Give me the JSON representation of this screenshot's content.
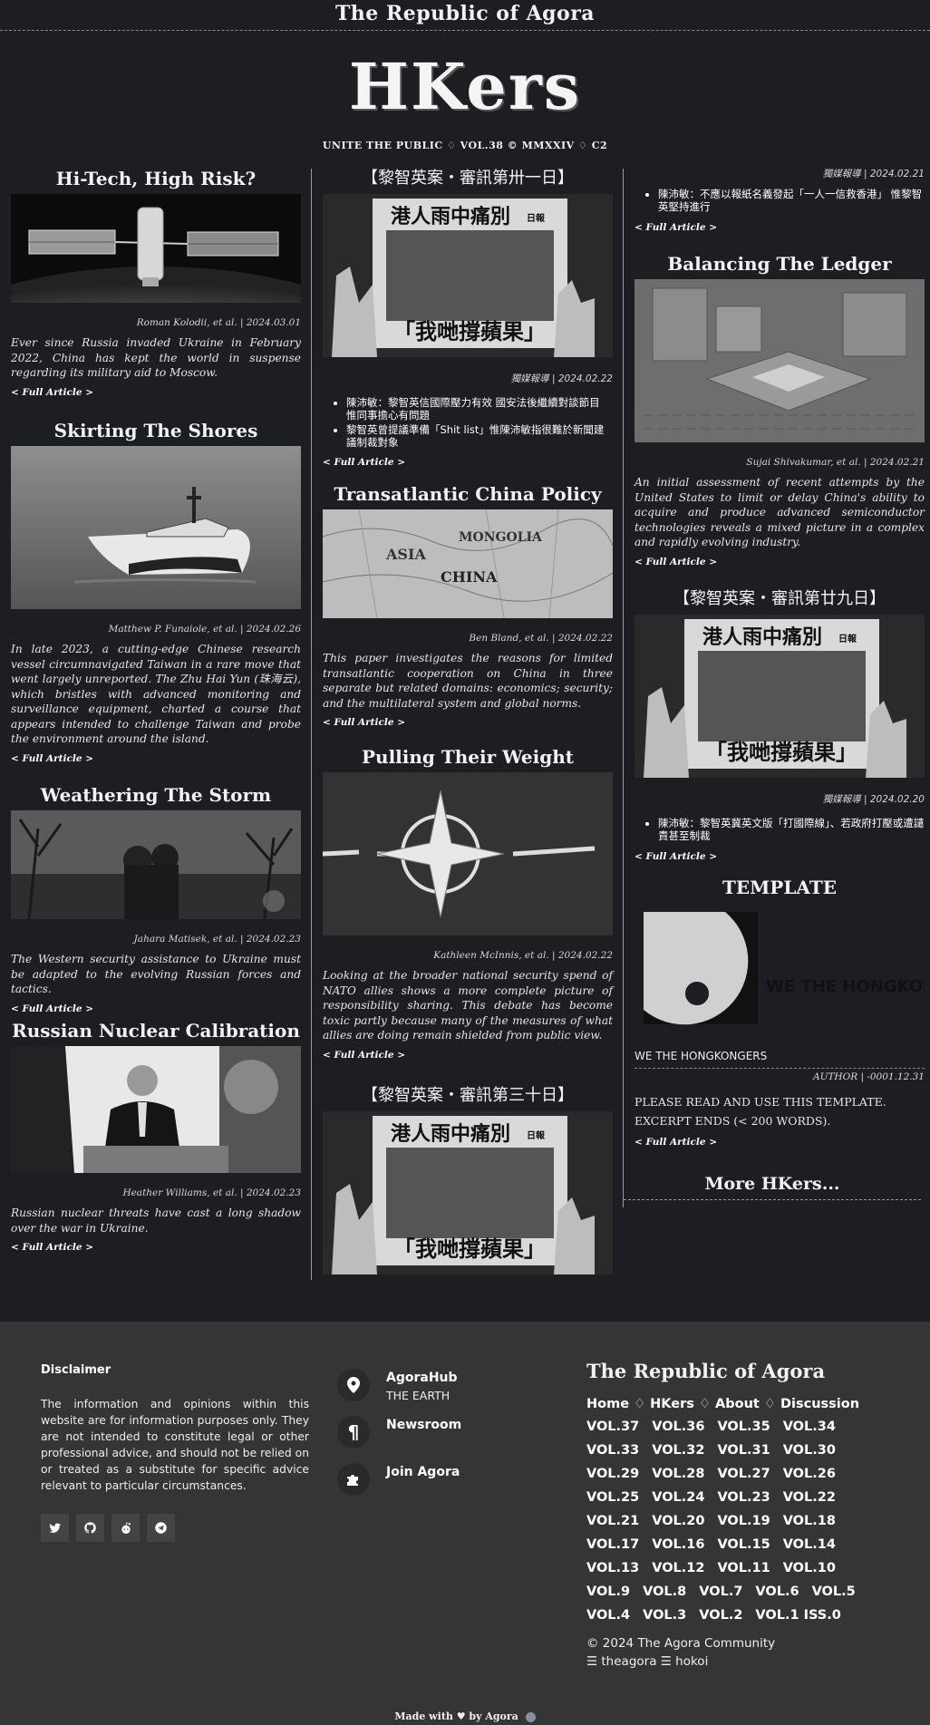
{
  "topbar": {
    "title": "The Republic of Agora"
  },
  "masthead": {
    "logo": "HKers",
    "subline": "UNITE THE PUBLIC ♢ VOL.38 © MMXXIV ♢ C2"
  },
  "full_article_label": "< Full Article >",
  "col1": [
    {
      "title": "Hi-Tech, High Risk?",
      "byline": "Roman Kolodii, et al. | 2024.03.01",
      "summary": "Ever since Russia invaded Ukraine in February 2022, China has kept the world in suspense regarding its military aid to Moscow."
    },
    {
      "title": "Skirting The Shores",
      "byline": "Matthew P. Funaiole, et al. | 2024.02.26",
      "summary": "In late 2023, a cutting-edge Chinese research vessel circumnavigated Taiwan in a rare move that went largely unreported. The Zhu Hai Yun (珠海云), which bristles with advanced monitoring and surveillance equipment, charted a course that appears intended to challenge Taiwan and probe the environment around the island."
    },
    {
      "title": "Weathering The Storm",
      "byline": "Jahara Matisek, et al. | 2024.02.23",
      "summary": "The Western security assistance to Ukraine must be adapted to the evolving Russian forces and tactics."
    },
    {
      "title": "Russian Nuclear Calibration",
      "byline": "Heather Williams, et al. | 2024.02.23",
      "summary": "Russian nuclear threats have cast a long shadow over the war in Ukraine."
    }
  ],
  "col2": [
    {
      "title": "【黎智英案・審訊第卅一日】",
      "byline": "獨媒報導 | 2024.02.22",
      "bullets": [
        "陳沛敏：黎智英信國際壓力有效 國安法後繼續對談節目 惟同事擔心有問題",
        "黎智英曾提議準備「Shit list」惟陳沛敏指很難於新聞建議制裁對象"
      ]
    },
    {
      "title": "Transatlantic China Policy",
      "byline": "Ben Bland, et al. | 2024.02.22",
      "summary": "This paper investigates the reasons for limited transatlantic cooperation on China in three separate but related domains: economics; security; and the multilateral system and global norms."
    },
    {
      "title": "Pulling Their Weight",
      "byline": "Kathleen McInnis, et al. | 2024.02.22",
      "summary": "Looking at the broader national security spend of NATO allies shows a more complete picture of responsibility sharing. This debate has become toxic partly because many of the measures of what allies are doing remain shielded from public view."
    },
    {
      "title": "【黎智英案・審訊第三十日】"
    }
  ],
  "col3": [
    {
      "byline": "獨媒報導 | 2024.02.21",
      "bullets": [
        "陳沛敏：不應以報紙名義發起「一人一信救香港」 惟黎智英堅持進行"
      ]
    },
    {
      "title": "Balancing The Ledger",
      "byline": "Sujai Shivakumar, et al. | 2024.02.21",
      "summary": "An initial assessment of recent attempts by the United States to limit or delay China's ability to acquire and produce advanced semiconductor technologies reveals a mixed picture in a complex and rapidly evolving industry."
    },
    {
      "title": "【黎智英案・審訊第廿九日】",
      "byline": "獨媒報導 | 2024.02.20",
      "bullets": [
        "陳沛敏：黎智英冀英文版「打國際線」、若政府打壓或遭譴責甚至制裁"
      ]
    },
    {
      "title": "TEMPLATE",
      "logo_caption": "WE THE HONGKONGERS",
      "byline_plain": "WE THE HONGKONGERS",
      "meta": "AUTHOR | -0001.12.31",
      "body1": "PLEASE READ AND USE THIS TEMPLATE.",
      "body2": "EXCERPT ENDS (< 200 WORDS)."
    }
  ],
  "more": "More HKers...",
  "newspaper_text": {
    "headline": "港人雨中痛別",
    "bottom": "「我哋撐蘋果」",
    "masthead": "日報",
    "map_label": "CHINA",
    "map_label2": "MONGOLIA",
    "map_label3": "ASIA"
  },
  "footer": {
    "disclaimer_title": "Disclaimer",
    "disclaimer_body": "The information and opinions within this website are for information purposes only. They are not intended to constitute legal or other professional advice, and should not be relied on or treated as a substitute for specific advice relevant to particular circumstances.",
    "contacts": [
      {
        "title": "AgoraHub",
        "sub": "THE EARTH",
        "icon": "location-pin-icon"
      },
      {
        "title": "Newsroom",
        "sub": "",
        "icon": "pilcrow-icon"
      },
      {
        "title": "Join Agora",
        "sub": "",
        "icon": "puzzle-icon"
      }
    ],
    "logo": "The Republic of Agora",
    "nav": [
      "Home",
      "HKers",
      "About",
      "Discussion"
    ],
    "nav_sep": "♢",
    "volumes": [
      "VOL.37",
      "VOL.36",
      "VOL.35",
      "VOL.34",
      "VOL.33",
      "VOL.32",
      "VOL.31",
      "VOL.30",
      "VOL.29",
      "VOL.28",
      "VOL.27",
      "VOL.26",
      "VOL.25",
      "VOL.24",
      "VOL.23",
      "VOL.22",
      "VOL.21",
      "VOL.20",
      "VOL.19",
      "VOL.18",
      "VOL.17",
      "VOL.16",
      "VOL.15",
      "VOL.14",
      "VOL.13",
      "VOL.12",
      "VOL.11",
      "VOL.10",
      "VOL.9",
      "VOL.8",
      "VOL.7",
      "VOL.6",
      "VOL.5",
      "VOL.4",
      "VOL.3",
      "VOL.2",
      "VOL.1 ISS.0"
    ],
    "copyright": "© 2024 The Agora Community",
    "handles": "☰ theagora ☰ hokoi",
    "socials": [
      "twitter-icon",
      "github-icon",
      "reddit-icon",
      "telegram-icon"
    ]
  },
  "madewith": "Made with ♥ by Agora"
}
